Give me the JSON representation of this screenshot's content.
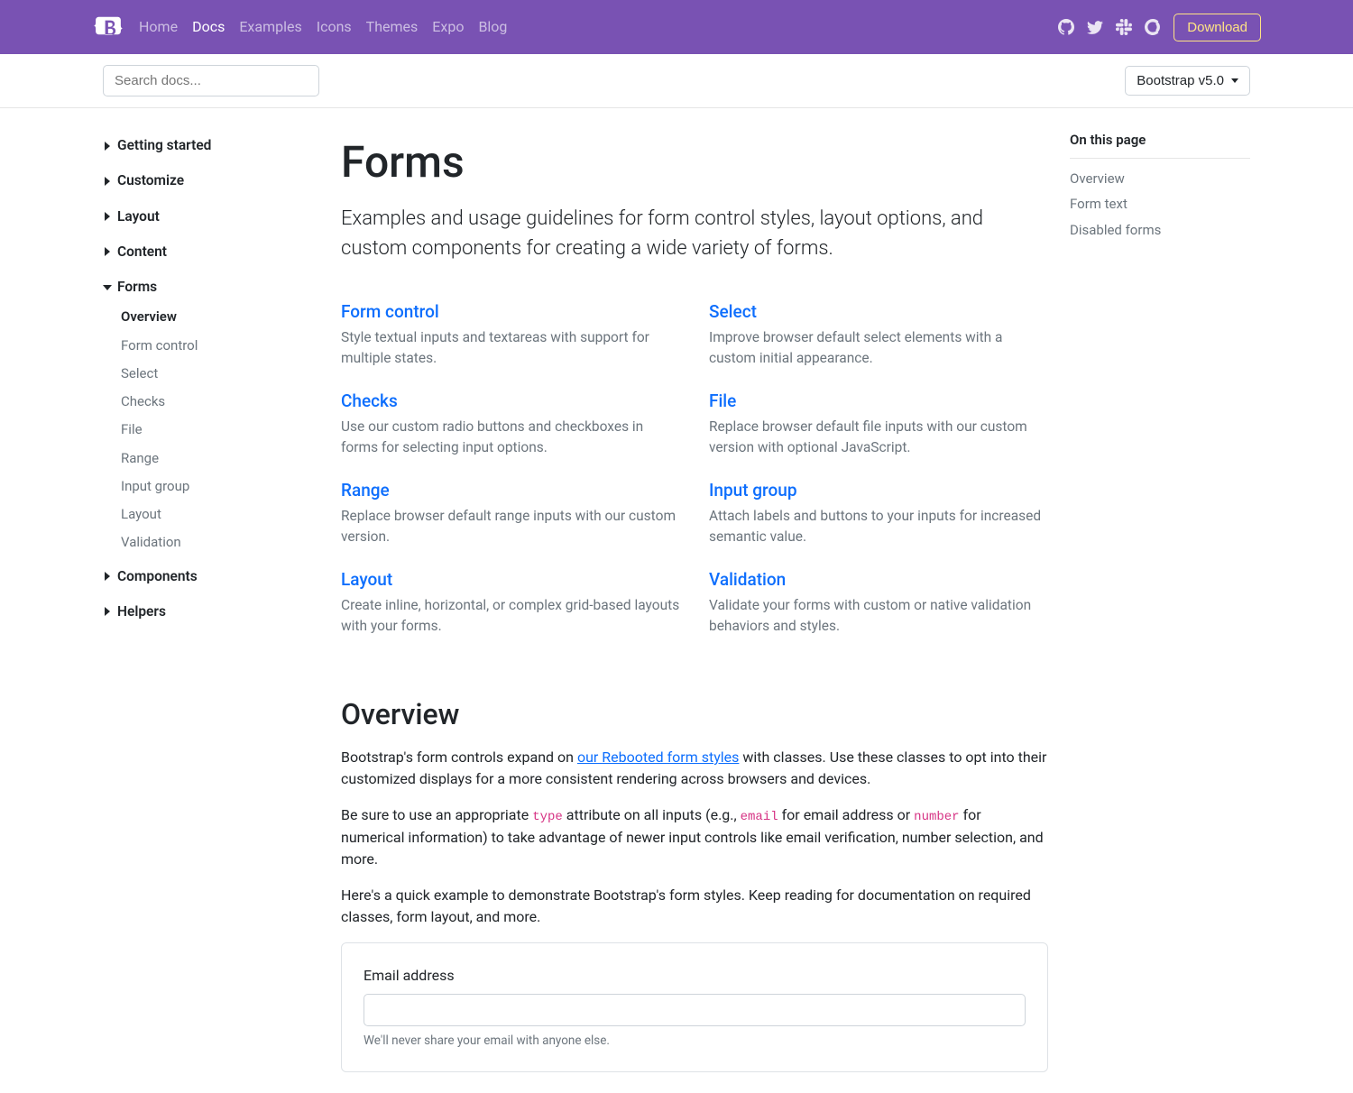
{
  "nav": {
    "links": [
      "Home",
      "Docs",
      "Examples",
      "Icons",
      "Themes",
      "Expo",
      "Blog"
    ],
    "active": "Docs",
    "download": "Download"
  },
  "subnav": {
    "search_placeholder": "Search docs...",
    "version": "Bootstrap v5.0"
  },
  "sidebar": {
    "sections": [
      {
        "label": "Getting started",
        "open": false
      },
      {
        "label": "Customize",
        "open": false
      },
      {
        "label": "Layout",
        "open": false
      },
      {
        "label": "Content",
        "open": false
      },
      {
        "label": "Forms",
        "open": true,
        "items": [
          {
            "label": "Overview",
            "active": true
          },
          {
            "label": "Form control"
          },
          {
            "label": "Select"
          },
          {
            "label": "Checks"
          },
          {
            "label": "File"
          },
          {
            "label": "Range"
          },
          {
            "label": "Input group"
          },
          {
            "label": "Layout"
          },
          {
            "label": "Validation"
          }
        ]
      },
      {
        "label": "Components",
        "open": false
      },
      {
        "label": "Helpers",
        "open": false
      }
    ]
  },
  "main": {
    "title": "Forms",
    "lead": "Examples and usage guidelines for form control styles, layout options, and custom components for creating a wide variety of forms.",
    "cards": [
      {
        "title": "Form control",
        "desc": "Style textual inputs and textareas with support for multiple states."
      },
      {
        "title": "Select",
        "desc": "Improve browser default select elements with a custom initial appearance."
      },
      {
        "title": "Checks",
        "desc": "Use our custom radio buttons and checkboxes in forms for selecting input options."
      },
      {
        "title": "File",
        "desc": "Replace browser default file inputs with our custom version with optional JavaScript."
      },
      {
        "title": "Range",
        "desc": "Replace browser default range inputs with our custom version."
      },
      {
        "title": "Input group",
        "desc": "Attach labels and buttons to your inputs for increased semantic value."
      },
      {
        "title": "Layout",
        "desc": "Create inline, horizontal, or complex grid-based layouts with your forms."
      },
      {
        "title": "Validation",
        "desc": "Validate your forms with custom or native validation behaviors and styles."
      }
    ],
    "overview": {
      "heading": "Overview",
      "para1_a": "Bootstrap's form controls expand on ",
      "para1_link": "our Rebooted form styles",
      "para1_b": " with classes. Use these classes to opt into their customized displays for a more consistent rendering across browsers and devices.",
      "para2_a": "Be sure to use an appropriate ",
      "para2_code1": "type",
      "para2_b": " attribute on all inputs (e.g., ",
      "para2_code2": "email",
      "para2_c": " for email address or ",
      "para2_code3": "number",
      "para2_d": " for numerical information) to take advantage of newer input controls like email verification, number selection, and more.",
      "para3": "Here's a quick example to demonstrate Bootstrap's form styles. Keep reading for documentation on required classes, form layout, and more."
    },
    "example": {
      "email_label": "Email address",
      "email_help": "We'll never share your email with anyone else."
    }
  },
  "toc": {
    "title": "On this page",
    "items": [
      "Overview",
      "Form text",
      "Disabled forms"
    ]
  }
}
